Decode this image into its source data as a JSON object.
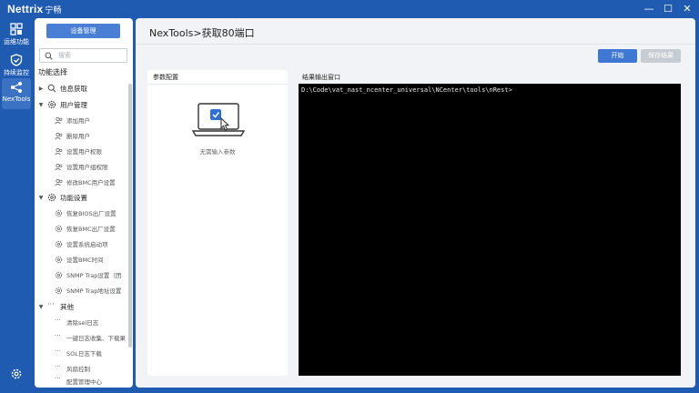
{
  "app": {
    "brand": "Nettrix",
    "brand_sub": "宁畅",
    "window_controls": {
      "minimize": "—",
      "maximize": "☐",
      "close": "✕"
    }
  },
  "rail": [
    {
      "label": "运维功能",
      "icon": "grid-icon"
    },
    {
      "label": "持续监控",
      "icon": "shield-icon"
    },
    {
      "label": "NexTools",
      "icon": "share-nodes-icon"
    }
  ],
  "sidebar": {
    "device_button": "设备管理",
    "search_placeholder": "搜索",
    "tree_title": "功能选择",
    "groups": [
      {
        "label": "信息获取",
        "expanded": false,
        "icon": "search-icon",
        "items": []
      },
      {
        "label": "用户管理",
        "expanded": true,
        "icon": "gear-icon",
        "items": [
          "添加用户",
          "删除用户",
          "设置用户权限",
          "设置用户组权限",
          "修改BMC用户设置"
        ]
      },
      {
        "label": "功能设置",
        "expanded": true,
        "icon": "gear-icon",
        "items": [
          "恢复BIOS出厂设置",
          "恢复BMC出厂设置",
          "设置系统启动项",
          "设置BMC时间",
          "SNMP Trap设置（团",
          "SNMP Trap地址设置"
        ]
      },
      {
        "label": "其他",
        "expanded": true,
        "icon": "ellipsis-icon",
        "items": [
          "清除sel日志",
          "一键日志收集、下载果",
          "SOL日志下载",
          "风扇控制",
          "配置管理中心"
        ]
      }
    ]
  },
  "main": {
    "title": "NexTools>获取80端口",
    "start_button": "开始",
    "save_button": "保存结果",
    "param_panel_title": "参数配置",
    "empty_text": "无需输入参数",
    "result_title": "结果输出窗口",
    "terminal_text": "D:\\Code\\vat_nast_ncenter_universal\\NCenter\\tools\\nRest>"
  },
  "colors": {
    "brand_blue": "#1f5bb0",
    "primary_button": "#3f78d4",
    "disabled_button": "#c7ccd3",
    "terminal_bg": "#000000"
  }
}
